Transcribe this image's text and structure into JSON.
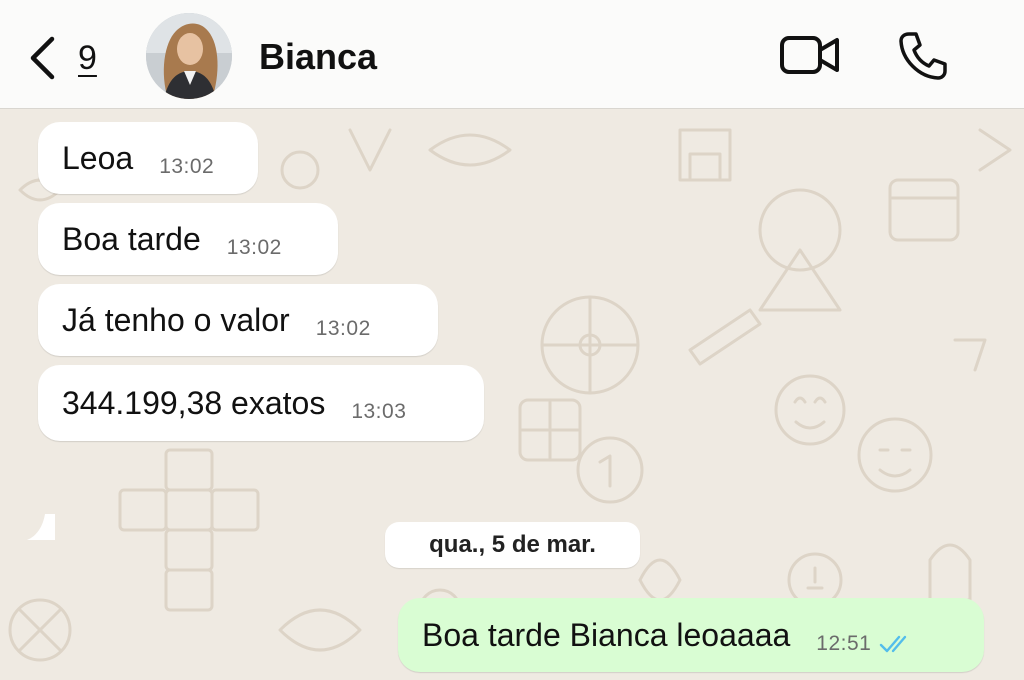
{
  "header": {
    "back_count": "9",
    "contact_name": "Bianca"
  },
  "messages": [
    {
      "direction": "in",
      "text": "Leoa",
      "time": "13:02"
    },
    {
      "direction": "in",
      "text": "Boa tarde",
      "time": "13:02"
    },
    {
      "direction": "in",
      "text": "Já tenho o valor",
      "time": "13:02"
    },
    {
      "direction": "in",
      "text": "344.199,38 exatos",
      "time": "13:03"
    },
    {
      "direction": "out",
      "text": "Boa tarde Bianca leoaaaa",
      "time": "12:51",
      "status": "read"
    }
  ],
  "date_separator": "qua., 5 de mar.",
  "icons": {
    "back": "chevron-left-icon",
    "video": "video-camera-icon",
    "call": "phone-icon",
    "read_receipt": "double-check-icon"
  },
  "colors": {
    "header_bg": "#fbfbfa",
    "chat_bg": "#efeae2",
    "incoming_bubble": "#ffffff",
    "outgoing_bubble": "#d9fdd3",
    "read_tick": "#53bdeb"
  }
}
